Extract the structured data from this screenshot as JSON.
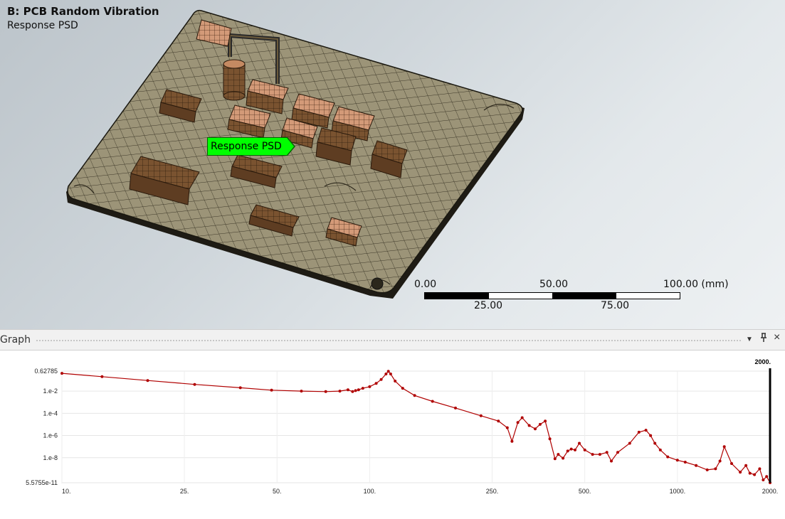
{
  "viewport": {
    "title": "B: PCB Random Vibration",
    "subtitle": "Response PSD",
    "probe_label": "Response PSD",
    "scale_bar": {
      "t0": "0.00",
      "t25": "25.00",
      "t50": "50.00",
      "t75": "75.00",
      "t100": "100.00 (mm)"
    }
  },
  "graph_panel": {
    "title": "Graph",
    "pin_icon": "pin-icon",
    "close_icon": "close-icon",
    "menu_icon": "chevron-down-icon"
  },
  "chart_data": {
    "type": "line",
    "xscale": "log",
    "yscale": "log",
    "xlim": [
      10,
      2000
    ],
    "ylim": [
      5.5755e-11,
      0.62785
    ],
    "x_tick_labels": [
      "10.",
      "25.",
      "50.",
      "100.",
      "250.",
      "500.",
      "1000.",
      "2000."
    ],
    "y_tick_labels": [
      "0.62785",
      "1.e-2",
      "1.e-4",
      "1.e-6",
      "1.e-8",
      "5.5755e-11"
    ],
    "cursor_label": "2000.",
    "line_color": "#b00000",
    "series": [
      {
        "x": [
          10,
          13.5,
          19,
          27,
          38,
          48,
          60,
          72,
          80,
          85,
          88,
          90,
          92,
          95,
          100,
          105,
          109,
          113,
          115,
          117,
          121,
          128,
          140,
          160,
          190,
          230,
          262,
          280,
          290,
          303,
          313,
          330,
          345,
          358,
          372,
          385,
          400,
          410,
          425,
          440,
          452,
          465,
          480,
          500,
          530,
          560,
          590,
          610,
          640,
          700,
          750,
          790,
          818,
          845,
          880,
          930,
          1000,
          1060,
          1150,
          1250,
          1330,
          1375,
          1420,
          1500,
          1600,
          1670,
          1720,
          1780,
          1850,
          1900,
          1950,
          2000
        ],
        "y": [
          0.4,
          0.2,
          0.09,
          0.04,
          0.02,
          0.012,
          0.01,
          0.009,
          0.01,
          0.013,
          0.009,
          0.011,
          0.013,
          0.018,
          0.025,
          0.05,
          0.11,
          0.35,
          0.6,
          0.35,
          0.08,
          0.018,
          0.004,
          0.0012,
          0.0003,
          6e-05,
          2e-05,
          5e-06,
          3e-07,
          1.5e-05,
          4e-05,
          8e-06,
          4e-06,
          1e-05,
          2e-05,
          5e-07,
          8e-09,
          2e-08,
          9e-09,
          4e-08,
          6e-08,
          5e-08,
          2e-07,
          5e-08,
          2e-08,
          2e-08,
          3e-08,
          5e-09,
          3e-08,
          2e-07,
          2e-06,
          3e-06,
          1e-06,
          2e-07,
          5e-08,
          1.2e-08,
          6e-09,
          4e-09,
          2e-09,
          8e-10,
          1e-09,
          5e-09,
          1e-07,
          3e-09,
          5e-10,
          2e-09,
          4e-10,
          3e-10,
          1e-09,
          1e-10,
          2e-10,
          5.5755e-11
        ]
      }
    ]
  }
}
